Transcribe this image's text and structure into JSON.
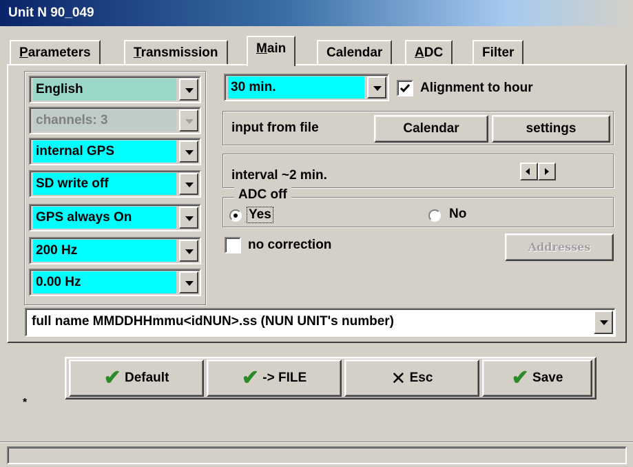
{
  "window": {
    "title": "Unit  N 90_049"
  },
  "tabs": [
    {
      "prefix": "",
      "hotkey": "P",
      "rest": "arameters"
    },
    {
      "prefix": "",
      "hotkey": "T",
      "rest": "ransmission"
    },
    {
      "prefix": "",
      "hotkey": "M",
      "rest": "ain"
    },
    {
      "prefix": "",
      "hotkey": "",
      "rest": "Calendar"
    },
    {
      "prefix": "",
      "hotkey": "A",
      "rest": "DC"
    },
    {
      "prefix": "",
      "hotkey": "",
      "rest": "Filter"
    }
  ],
  "left_combos": [
    {
      "value": "English",
      "color": "#99d8c8"
    },
    {
      "value": "channels: 3",
      "color": "#c0ccc8",
      "disabled": true
    },
    {
      "value": "internal GPS",
      "color": "#00ffff"
    },
    {
      "value": "SD write off",
      "color": "#00ffff"
    },
    {
      "value": "GPS always On",
      "color": "#00ffff"
    },
    {
      "value": "200 Hz",
      "color": "#00ffff"
    },
    {
      "value": "0.00 Hz",
      "color": "#00ffff"
    }
  ],
  "main": {
    "period_combo": "30  min.",
    "alignment_label": "Alignment to hour",
    "alignment_checked": true,
    "input_from_file": "input from file",
    "calendar_button": "Calendar",
    "settings_button": "settings",
    "interval_text": "interval  ~2  min.",
    "adc_group_label": "ADC off",
    "radio_yes": "Yes",
    "radio_no": "No",
    "radio_selected": "Yes",
    "no_correction_label": "no correction",
    "addresses_button": "Addresses"
  },
  "filename_combo": "full name MMDDHHmmu<idNUN>.ss  (NUN  UNIT's number)",
  "buttons": {
    "default": "Default",
    "to_file": "-> FILE",
    "esc": "Esc",
    "save": "Save"
  },
  "footnote": "*",
  "colors": {
    "accent_cyan": "#00ffff",
    "teal": "#99d8c8",
    "face": "#d4d0c8",
    "title_blue": "#0a246a",
    "check_green": "#2a8a2a"
  }
}
